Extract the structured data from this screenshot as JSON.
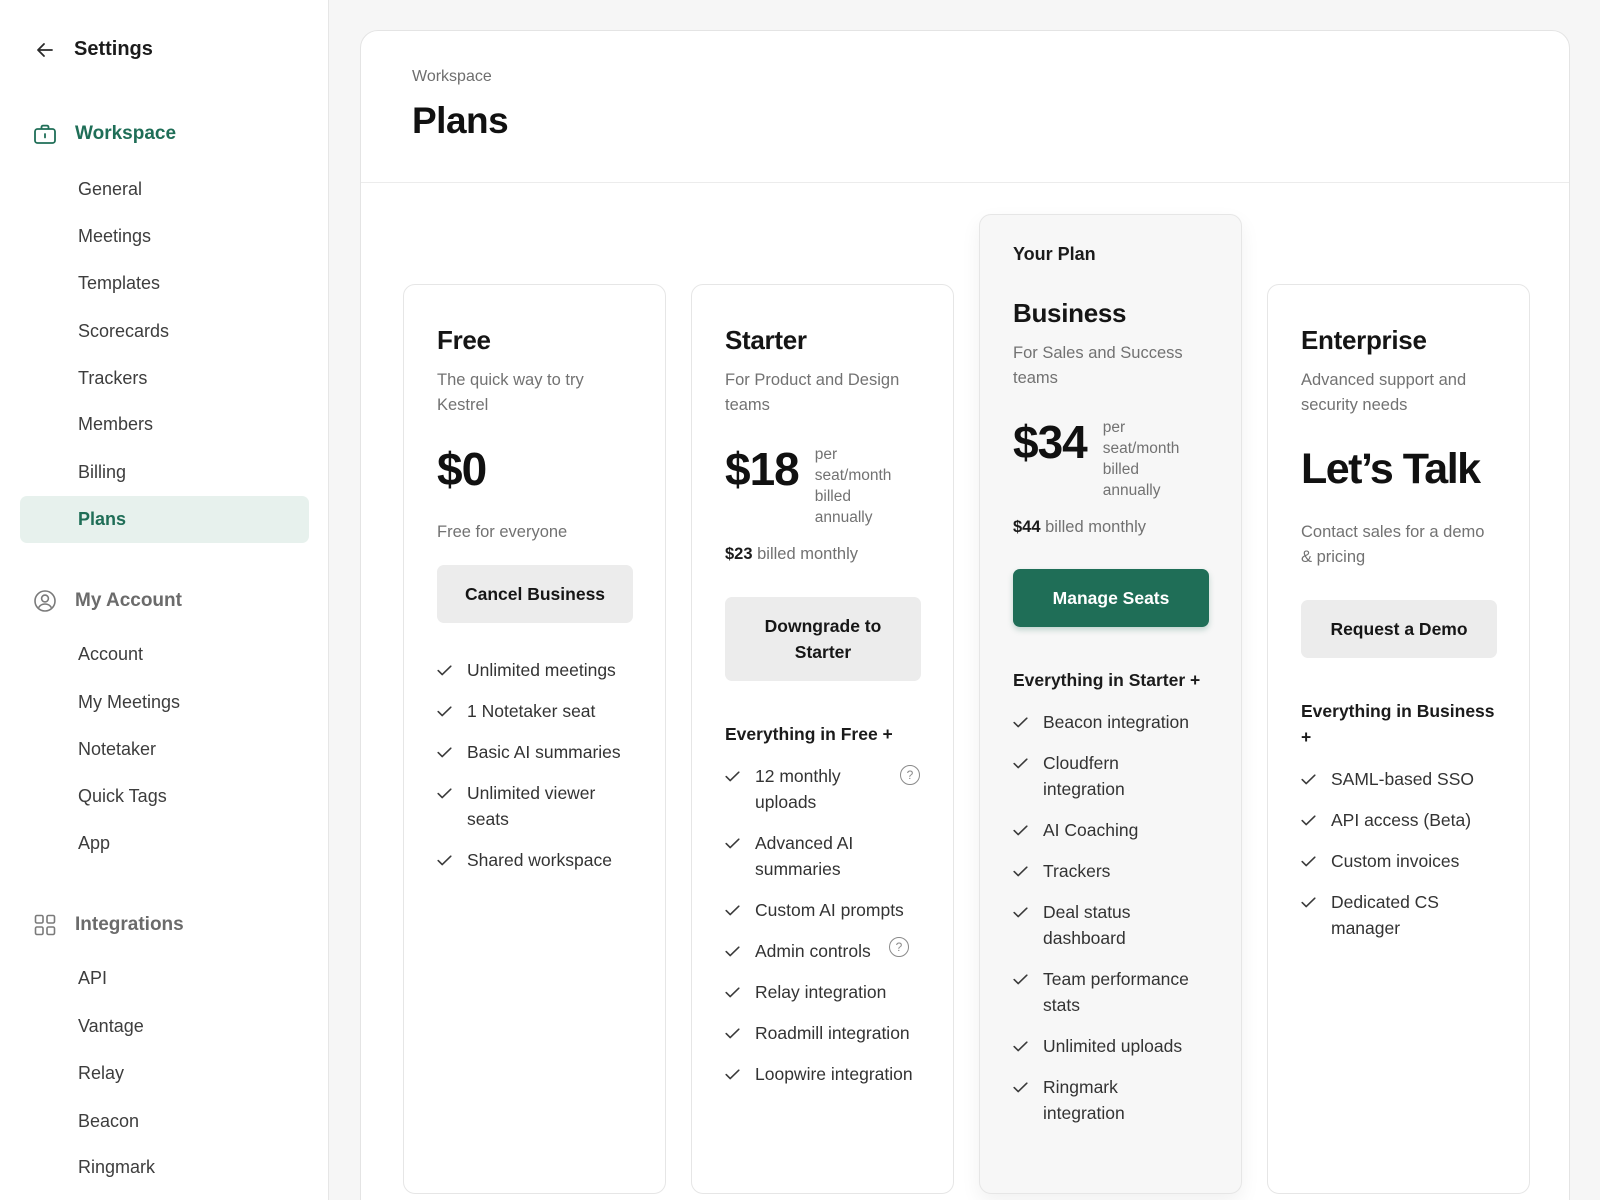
{
  "sidebar": {
    "title": "Settings",
    "groups": [
      {
        "label": "Workspace",
        "icon": "briefcase-icon",
        "items": [
          "General",
          "Meetings",
          "Templates",
          "Scorecards",
          "Trackers",
          "Members",
          "Billing",
          "Plans"
        ]
      },
      {
        "label": "My Account",
        "icon": "user-circle-icon",
        "items": [
          "Account",
          "My Meetings",
          "Notetaker",
          "Quick Tags",
          "App"
        ]
      },
      {
        "label": "Integrations",
        "icon": "grid-icon",
        "items": [
          "API",
          "Vantage",
          "Relay",
          "Beacon",
          "Ringmark"
        ]
      }
    ],
    "active_item": "Plans"
  },
  "header": {
    "breadcrumb": "Workspace",
    "title": "Plans"
  },
  "colors": {
    "accent": "#1f6e57",
    "accent_bg": "#e7f1ed",
    "button_bg": "#ececec"
  },
  "plans": [
    {
      "name": "Free",
      "desc": "The quick way to try Kestrel",
      "price": "$0",
      "price_note": "Free for everyone",
      "button": "Cancel Business",
      "features": [
        "Unlimited meetings",
        "1 Notetaker seat",
        "Basic AI summaries",
        "Unlimited viewer seats",
        "Shared workspace"
      ]
    },
    {
      "name": "Starter",
      "desc": "For Product and Design teams",
      "price": "$18",
      "price_unit": "per seat/month billed annually",
      "monthly_price": "$23",
      "monthly_suffix": "billed monthly",
      "button": "Downgrade to Starter",
      "features_heading": "Everything in Free +",
      "features": [
        "12 monthly uploads",
        "Advanced AI summaries",
        "Custom AI prompts",
        "Admin controls",
        "Relay integration",
        "Roadmill integration",
        "Loopwire integration"
      ],
      "help_glyph": "?"
    },
    {
      "badge": "Your Plan",
      "name": "Business",
      "desc": "For Sales and Success teams",
      "price": "$34",
      "price_unit": "per seat/month billed annually",
      "monthly_price": "$44",
      "monthly_suffix": "billed monthly",
      "button": "Manage Seats",
      "features_heading": "Everything in Starter +",
      "features": [
        "Beacon integration",
        "Cloudfern integration",
        "AI Coaching",
        "Trackers",
        "Deal status dashboard",
        "Team performance stats",
        "Unlimited uploads",
        "Ringmark integration"
      ]
    },
    {
      "name": "Enterprise",
      "desc": "Advanced support and security needs",
      "price": "Let’s Talk",
      "price_note": "Contact sales for a demo & pricing",
      "button": "Request a Demo",
      "features_heading": "Everything in Business +",
      "features": [
        "SAML-based SSO",
        "API access (Beta)",
        "Custom invoices",
        "Dedicated CS manager"
      ]
    }
  ]
}
